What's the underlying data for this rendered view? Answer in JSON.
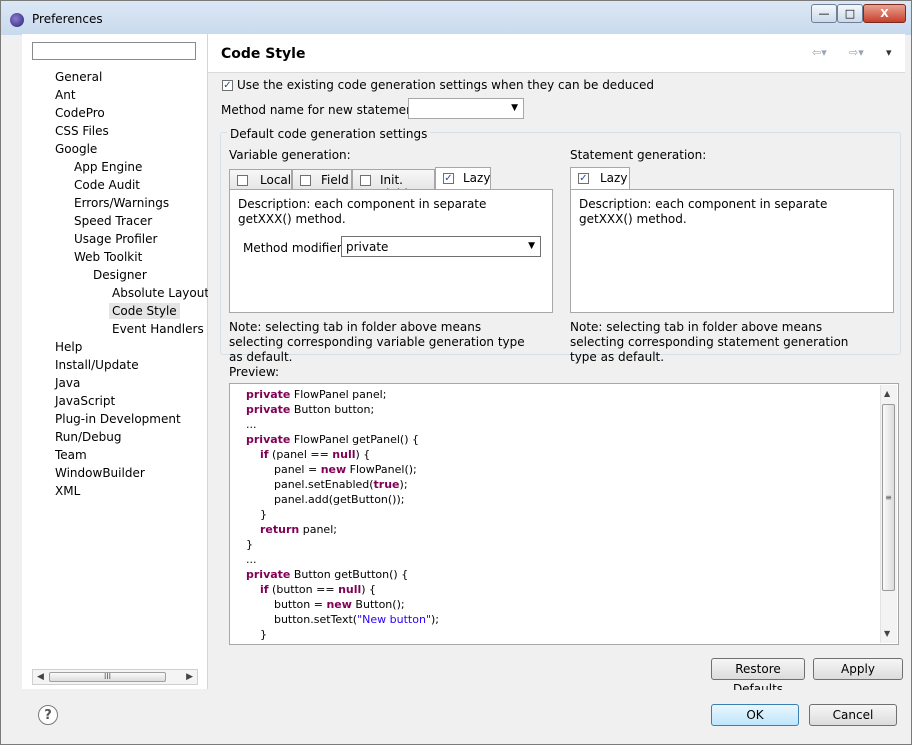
{
  "window": {
    "title": "Preferences",
    "minimize": "—",
    "maximize": "□",
    "close": "X"
  },
  "sidebar": {
    "filter_value": "",
    "items": [
      {
        "label": "General",
        "level": 0
      },
      {
        "label": "Ant",
        "level": 0
      },
      {
        "label": "CodePro",
        "level": 0
      },
      {
        "label": "CSS Files",
        "level": 0
      },
      {
        "label": "Google",
        "level": 0
      },
      {
        "label": "App Engine",
        "level": 1
      },
      {
        "label": "Code Audit",
        "level": 1
      },
      {
        "label": "Errors/Warnings",
        "level": 1
      },
      {
        "label": "Speed Tracer",
        "level": 1
      },
      {
        "label": "Usage Profiler",
        "level": 1
      },
      {
        "label": "Web Toolkit",
        "level": 1
      },
      {
        "label": "Designer",
        "level": 2
      },
      {
        "label": "Absolute Layout",
        "level": 3
      },
      {
        "label": "Code Style",
        "level": 3,
        "selected": true
      },
      {
        "label": "Event Handlers",
        "level": 3
      },
      {
        "label": "Help",
        "level": 0
      },
      {
        "label": "Install/Update",
        "level": 0
      },
      {
        "label": "Java",
        "level": 0
      },
      {
        "label": "JavaScript",
        "level": 0
      },
      {
        "label": "Plug-in Development",
        "level": 0
      },
      {
        "label": "Run/Debug",
        "level": 0
      },
      {
        "label": "Team",
        "level": 0
      },
      {
        "label": "WindowBuilder",
        "level": 0
      },
      {
        "label": "XML",
        "level": 0
      }
    ],
    "scroll_grip": "III"
  },
  "page": {
    "title": "Code Style",
    "use_existing_label": "Use the existing code generation settings when they can be deduced",
    "use_existing_checked": true,
    "method_name_label": "Method name for new statements:",
    "method_name_value": "",
    "default_group_label": "Default code generation settings",
    "variable_generation_label": "Variable generation:",
    "statement_generation_label": "Statement generation:",
    "variable_tabs": [
      {
        "label": "Local",
        "checked": false
      },
      {
        "label": "Field",
        "checked": false
      },
      {
        "label": "Init. Field",
        "checked": false
      },
      {
        "label": "Lazy",
        "checked": true
      }
    ],
    "statement_tabs": [
      {
        "label": "Lazy",
        "checked": true
      }
    ],
    "variable_description": "Description: each component in separate getXXX() method.",
    "method_modifier_label": "Method modifier:",
    "method_modifier_value": "private",
    "statement_description": "Description: each component in separate getXXX() method.",
    "variable_note": "Note: selecting tab in folder above means selecting corresponding variable generation type as default.",
    "statement_note": "Note: selecting tab in folder above means selecting corresponding statement generation type as default.",
    "preview_label": "Preview:",
    "scroll_grip": "≡"
  },
  "buttons": {
    "restore_defaults": "Restore Defaults",
    "apply": "Apply",
    "ok": "OK",
    "cancel": "Cancel",
    "help": "?"
  },
  "colors": {
    "keyword": "#7f0055",
    "string": "#2a00ff"
  }
}
